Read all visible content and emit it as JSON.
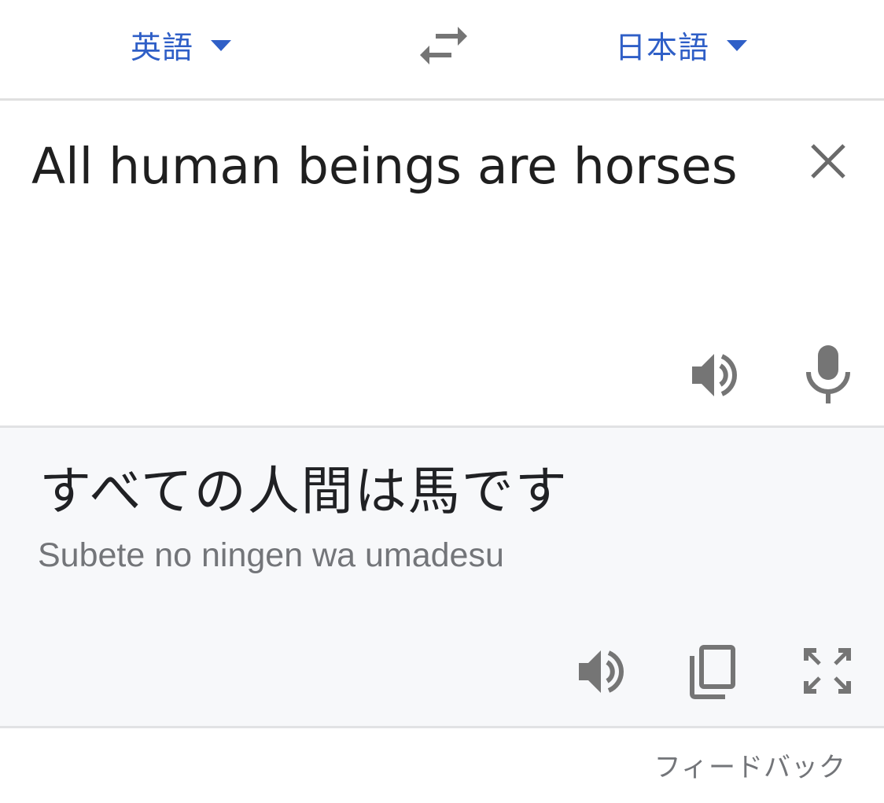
{
  "language_bar": {
    "source_language": "英語",
    "target_language": "日本語",
    "swap_icon": "swap-arrows-icon",
    "dropdown_icon": "caret-down-icon"
  },
  "source": {
    "text": "All human beings are horses",
    "clear_icon": "close-icon",
    "speak_icon": "speaker-icon",
    "mic_icon": "microphone-icon"
  },
  "result": {
    "translation": "すべての人間は馬です",
    "romanization": "Subete no ningen wa umadesu",
    "speak_icon": "speaker-icon",
    "copy_icon": "copy-icon",
    "fullscreen_icon": "fullscreen-icon"
  },
  "footer": {
    "feedback_label": "フィードバック"
  },
  "colors": {
    "accent": "#2f5fc7",
    "icon_gray": "#757575",
    "text_dark": "#1f1f1f",
    "text_muted": "#737579",
    "result_background": "#f7f8fa",
    "divider": "#e0e0e0"
  }
}
